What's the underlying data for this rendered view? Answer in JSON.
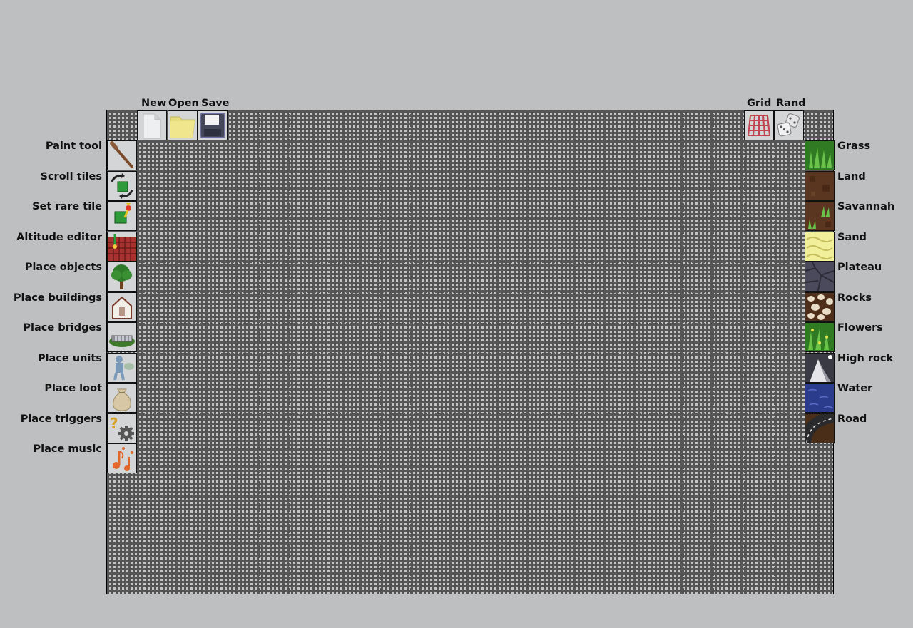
{
  "toolbar": {
    "new_label": "New",
    "open_label": "Open",
    "save_label": "Save",
    "grid_label": "Grid",
    "rand_label": "Rand"
  },
  "tools": [
    {
      "label": "Paint tool",
      "icon": "paintbrush-icon"
    },
    {
      "label": "Scroll tiles",
      "icon": "scroll-arrows-icon"
    },
    {
      "label": "Set rare tile",
      "icon": "rare-tile-icon"
    },
    {
      "label": "Altitude editor",
      "icon": "altitude-grid-icon"
    },
    {
      "label": "Place objects",
      "icon": "tree-icon"
    },
    {
      "label": "Place buildings",
      "icon": "house-icon"
    },
    {
      "label": "Place bridges",
      "icon": "bridge-icon"
    },
    {
      "label": "Place units",
      "icon": "unit-figure-icon"
    },
    {
      "label": "Place loot",
      "icon": "loot-bag-icon"
    },
    {
      "label": "Place triggers",
      "icon": "trigger-gear-icon"
    },
    {
      "label": "Place music",
      "icon": "music-notes-icon"
    }
  ],
  "terrains": [
    {
      "label": "Grass",
      "icon": "grass-tile-icon"
    },
    {
      "label": "Land",
      "icon": "land-tile-icon"
    },
    {
      "label": "Savannah",
      "icon": "savannah-tile-icon"
    },
    {
      "label": "Sand",
      "icon": "sand-tile-icon"
    },
    {
      "label": "Plateau",
      "icon": "plateau-tile-icon"
    },
    {
      "label": "Rocks",
      "icon": "rocks-tile-icon"
    },
    {
      "label": "Flowers",
      "icon": "flowers-tile-icon"
    },
    {
      "label": "High rock",
      "icon": "high-rock-tile-icon"
    },
    {
      "label": "Water",
      "icon": "water-tile-icon"
    },
    {
      "label": "Road",
      "icon": "road-tile-icon"
    }
  ]
}
